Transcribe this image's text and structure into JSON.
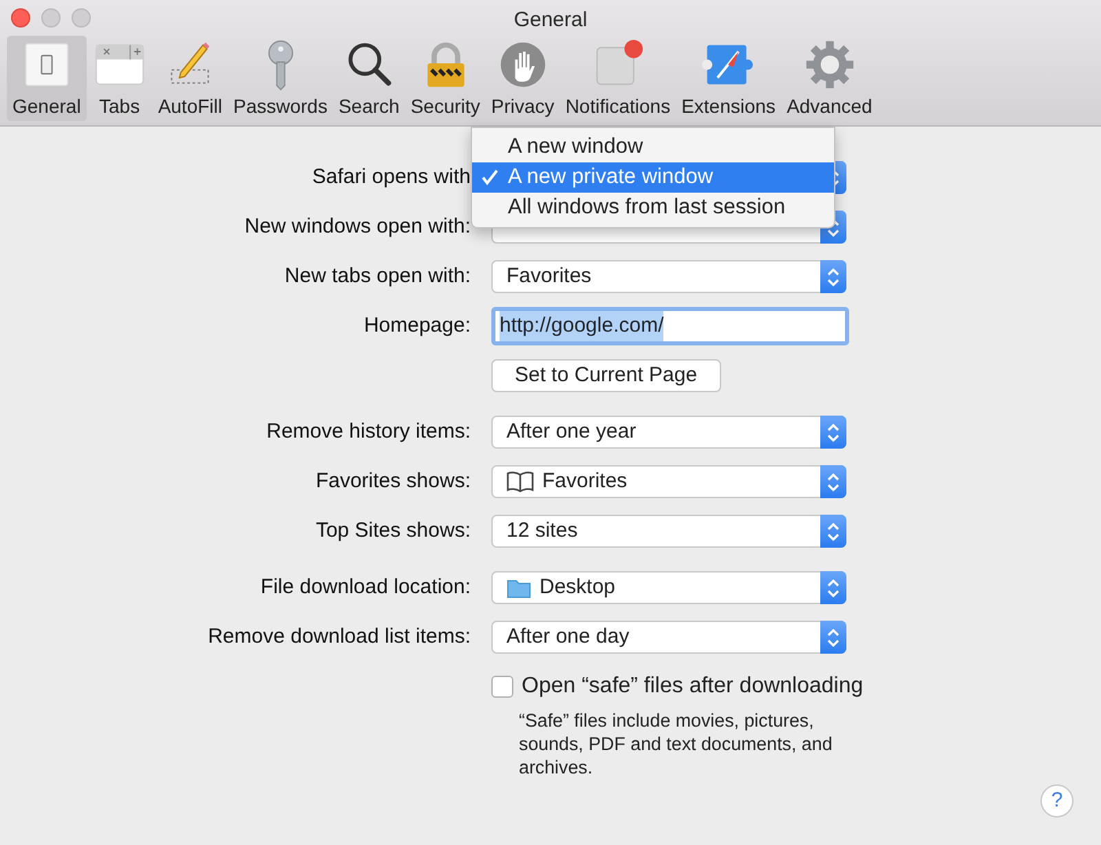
{
  "window": {
    "title": "General"
  },
  "toolbar": [
    {
      "label": "General",
      "kind": "general",
      "selected": true
    },
    {
      "label": "Tabs",
      "kind": "tabs",
      "selected": false
    },
    {
      "label": "AutoFill",
      "kind": "autofill",
      "selected": false
    },
    {
      "label": "Passwords",
      "kind": "passwords",
      "selected": false
    },
    {
      "label": "Search",
      "kind": "search",
      "selected": false
    },
    {
      "label": "Security",
      "kind": "security",
      "selected": false
    },
    {
      "label": "Privacy",
      "kind": "privacy",
      "selected": false
    },
    {
      "label": "Notifications",
      "kind": "notifications",
      "selected": false
    },
    {
      "label": "Extensions",
      "kind": "extensions",
      "selected": false
    },
    {
      "label": "Advanced",
      "kind": "advanced",
      "selected": false
    }
  ],
  "sections": [
    [
      {
        "kind": "popup",
        "label": "Safari opens with"
      },
      {
        "kind": "popup",
        "label": "New windows open with:"
      },
      {
        "kind": "popup",
        "label": "New tabs open with:",
        "value": "Favorites"
      },
      {
        "kind": "text",
        "label": "Homepage:",
        "value": "http://google.com/",
        "focused": true,
        "text_selected": true
      },
      {
        "kind": "button",
        "value": "Set to Current Page"
      }
    ],
    [
      {
        "kind": "popup",
        "label": "Remove history items:",
        "value": "After one year"
      },
      {
        "kind": "bookmarks_popup",
        "label": "Favorites shows:",
        "value": "Favorites"
      },
      {
        "kind": "popup",
        "label": "Top Sites shows:",
        "value": "12 sites"
      }
    ],
    [
      {
        "kind": "folder_popup",
        "label": "File download location:",
        "value": "Desktop"
      },
      {
        "kind": "popup",
        "label": "Remove download list items:",
        "value": "After one day"
      },
      {
        "kind": "checkbox",
        "value": "Open “safe” files after downloading",
        "checked": false,
        "note": "“Safe” files include movies, pictures, sounds, PDF and text documents, and archives."
      }
    ]
  ],
  "popup_menu": {
    "items": [
      {
        "label": "A new window",
        "selected": false
      },
      {
        "label": "A new private window",
        "selected": true
      },
      {
        "label": "All windows from last session",
        "selected": false
      }
    ]
  },
  "help_button": "?"
}
